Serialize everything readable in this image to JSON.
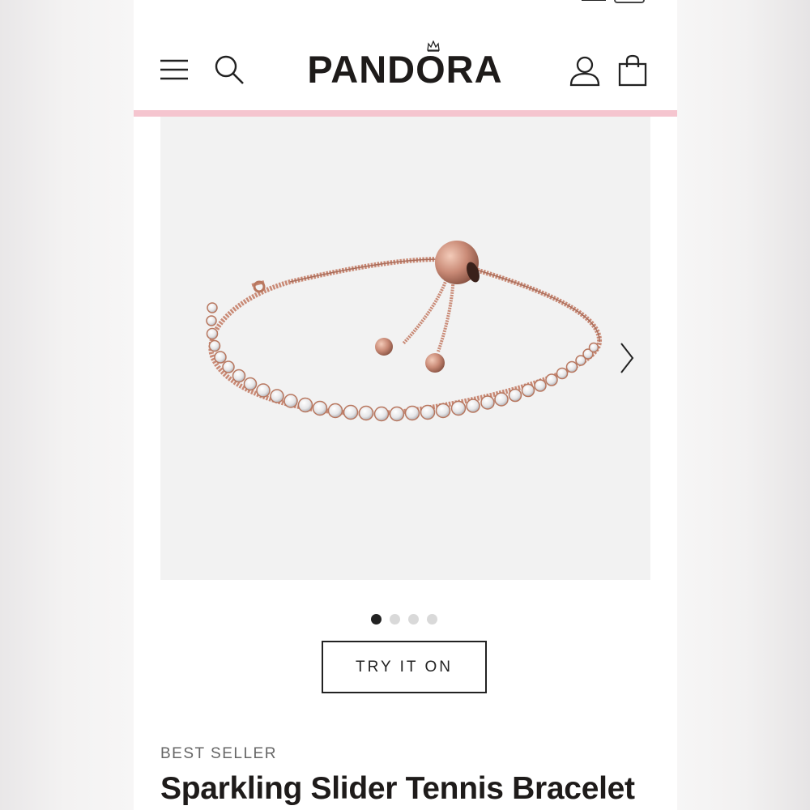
{
  "brand": {
    "name": "PANDORA"
  },
  "header": {
    "menu_icon": "hamburger-menu-icon",
    "search_icon": "search-icon",
    "account_icon": "user-account-icon",
    "bag_icon": "shopping-bag-icon",
    "accent_bar_color": "#f5c5cf"
  },
  "gallery": {
    "image": "rose-gold-slider-tennis-bracelet",
    "next_icon": "chevron-right-icon",
    "slide_count": 4,
    "active_slide": 1
  },
  "actions": {
    "try_on_label": "TRY IT ON"
  },
  "product": {
    "badge": "BEST SELLER",
    "title": "Sparkling Slider Tennis Bracelet"
  },
  "colors": {
    "rose_gold": "#c98a76",
    "text_dark": "#1e1b1a",
    "gallery_bg": "#f2f2f2"
  }
}
